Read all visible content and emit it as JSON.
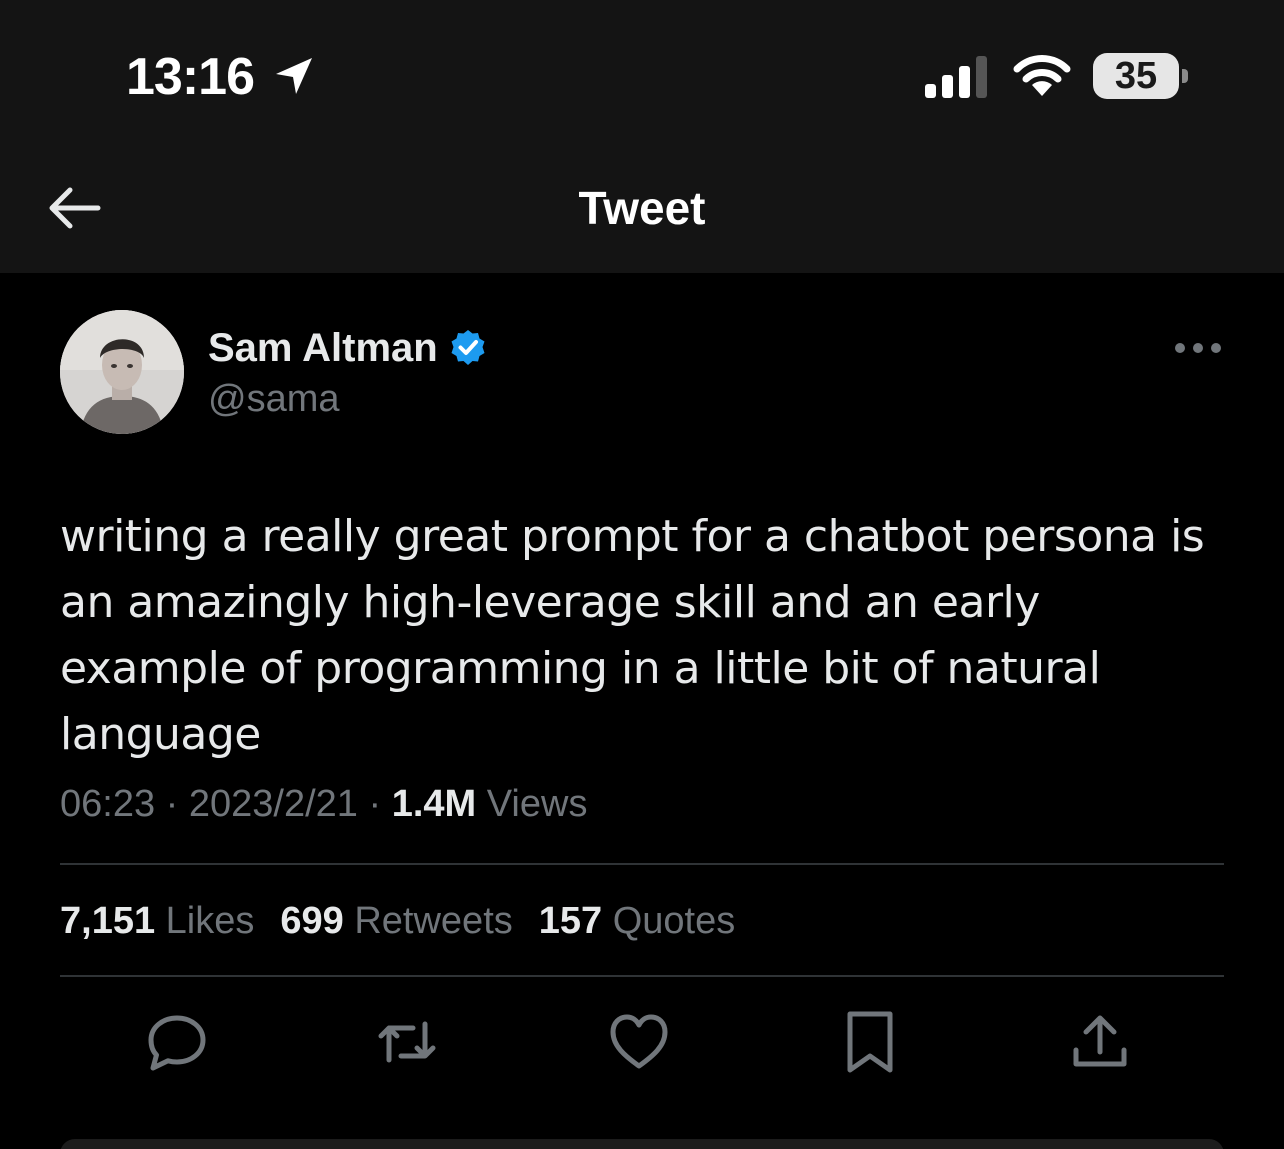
{
  "status_bar": {
    "time": "13:16",
    "battery_level": "35",
    "icons": [
      "location-arrow-icon",
      "signal-icon",
      "wifi-icon",
      "battery-icon"
    ]
  },
  "nav": {
    "title": "Tweet",
    "back_icon": "arrow-left-icon"
  },
  "tweet": {
    "author": {
      "name": "Sam Altman",
      "handle": "@sama",
      "verified": true
    },
    "text": "writing a really great prompt for a chatbot persona is an amazingly high-leverage skill and an early example of programming in a little bit of natural language",
    "time": "06:23",
    "separator": "·",
    "date": "2023/2/21",
    "views_count": "1.4M",
    "views_label": "Views",
    "stats": {
      "likes_count": "7,151",
      "likes_label": "Likes",
      "retweets_count": "699",
      "retweets_label": "Retweets",
      "quotes_count": "157",
      "quotes_label": "Quotes"
    },
    "actions": [
      "reply-icon",
      "retweet-icon",
      "like-icon",
      "bookmark-icon",
      "share-icon"
    ]
  },
  "colors": {
    "background": "#000000",
    "header_background": "#141414",
    "primary_text": "#e7e9ea",
    "secondary_text": "#71767b",
    "verified_blue": "#1d9bf0",
    "divider": "#2f3336"
  }
}
